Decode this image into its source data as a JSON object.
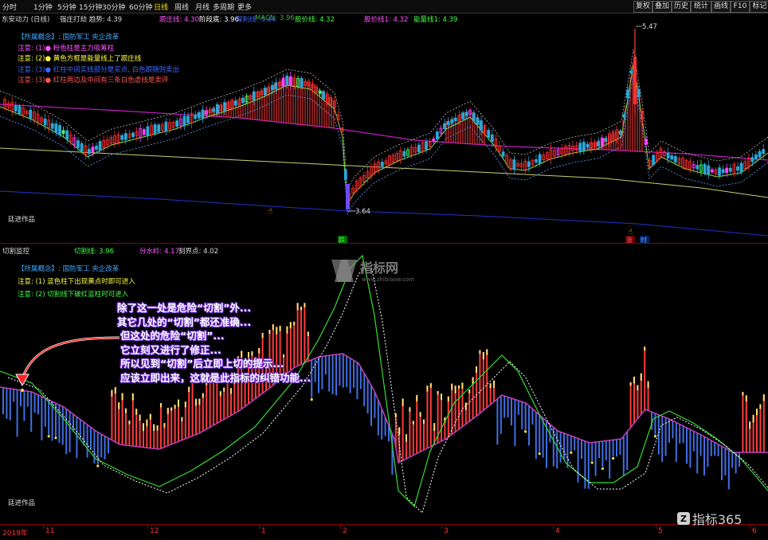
{
  "toolbar": {
    "periods": [
      "分时",
      "1分钟",
      "5分钟",
      "15分钟",
      "30分钟",
      "60分钟",
      "日线",
      "周线",
      "月线",
      "多周期",
      "更多"
    ],
    "selected": "日线",
    "right_buttons": [
      "复权",
      "叠加",
      "历史",
      "统计",
      "画线",
      "F10",
      "标记"
    ]
  },
  "main_header": {
    "stock": "东安动力 (日线)",
    "items": [
      {
        "text": "强庄打劫 趋势: 4.39",
        "color": "#dddddd"
      },
      {
        "text": "跟庄线: 4.30",
        "color": "#ff55ff"
      },
      {
        "text": "阶段底: 3.96",
        "color": "#ffffff"
      },
      {
        "text": "保利线: 3.44",
        "color": "#4466ff"
      },
      {
        "text": "MACN: 3.96",
        "color": "#44aa44"
      },
      {
        "text": "股价线: 4.32",
        "color": "#44ff44"
      },
      {
        "text": "股价线1: 4.32",
        "color": "#ff55ff"
      },
      {
        "text": "能量线1: 4.39",
        "color": "#44ff44"
      }
    ]
  },
  "main_notes": [
    {
      "text": "【所属概念】: 国防军工 央企改革",
      "color": "#44aaff"
    },
    {
      "text": "注意: (1)● 粉色柱是主力吸筹柱",
      "color": "#ff55ff"
    },
    {
      "text": "注意: (2)● 黄色方框是能量线上了跟庄线",
      "color": "#ffff44"
    },
    {
      "text": "注意: (3)● 红柱中间实线部分是买点, 白色跟随则卖出",
      "color": "#4466ff"
    },
    {
      "text": "注意: (3)● 红柱两边及中间有三条白色虚线是卖评",
      "color": "#ff5555"
    }
  ],
  "main_labels": {
    "high_price": "5.47",
    "low_price": "3.64",
    "author": "廷进作品",
    "fall_marker": "跌",
    "rise_marker": "涨",
    "time_marker": "时"
  },
  "sub_header": {
    "name": "切割监控",
    "items": [
      {
        "text": "切割线: 3.96",
        "color": "#44ff44"
      },
      {
        "text": "分水岭: 4.17",
        "color": "#ff55ff"
      },
      {
        "text": "刻界点: 4.02",
        "color": "#dddddd"
      }
    ]
  },
  "sub_notes": [
    {
      "text": "【所属概念】: 国防军工 央企改革",
      "color": "#44aaff"
    },
    {
      "text": "注意: (1) 蓝色柱下出现黄点时即可进入",
      "color": "#ffff44"
    },
    {
      "text": "注意: (2) 切割线下破红蓝柱时可进入",
      "color": "#44ff44"
    }
  ],
  "sub_labels": {
    "author": "廷进作品"
  },
  "annotation": [
    "除了这一处是危险“切割”外...",
    "其它几处的“切割”都还准确...",
    "但这处的危险“切割”...",
    "它立刻又进行了修正...",
    "所以见到“切割”后立即上切的提示...",
    "应该立即出来，这就是此指标的纠错功能..."
  ],
  "bottom_axis": [
    "2019年",
    "11",
    "12",
    "1",
    "2",
    "3",
    "4",
    "5",
    "6"
  ],
  "watermark": {
    "brand": "指标网",
    "url": "www.zhibiaow.com"
  },
  "corner_logo": "指标365",
  "colors": {
    "up": "#ff3030",
    "down": "#3f7cff",
    "mauve": "#c040c0",
    "grid_red": "#8b0000"
  }
}
